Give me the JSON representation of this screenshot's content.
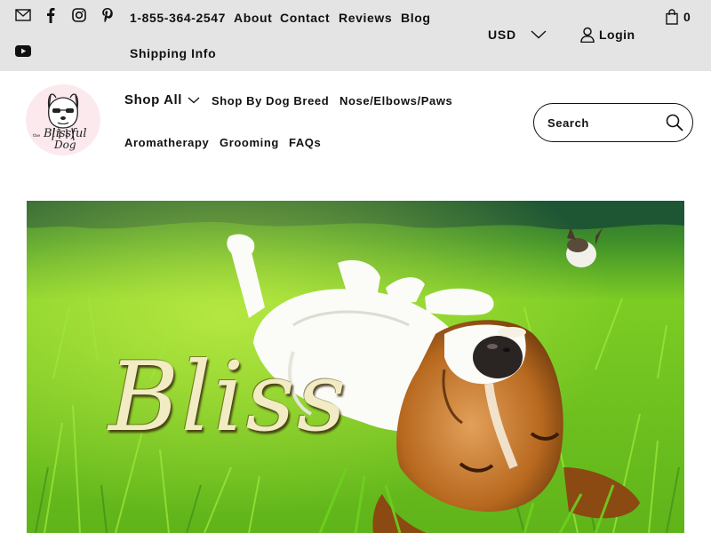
{
  "topbar": {
    "phone": "1-855-364-2547",
    "links": {
      "about": "About",
      "contact": "Contact",
      "reviews": "Reviews",
      "blog": "Blog",
      "shipping": "Shipping Info"
    },
    "social_icons": [
      "email-icon",
      "facebook-icon",
      "instagram-icon",
      "pinterest-icon",
      "youtube-icon"
    ],
    "currency": "USD",
    "login_label": "Login",
    "cart_count": "0"
  },
  "header": {
    "logo_text": {
      "the": "the",
      "name": "Blissful",
      "dog": "Dog"
    },
    "nav": {
      "shop_all": "Shop All",
      "shop_by_breed": "Shop By Dog Breed",
      "nose_elbows_paws": "Nose/Elbows/Paws",
      "aromatherapy": "Aromatherapy",
      "grooming": "Grooming",
      "faqs": "FAQs"
    },
    "search": {
      "placeholder": "Search"
    }
  },
  "hero": {
    "title": "Bliss"
  },
  "colors": {
    "topbar_bg": "#e4e4e4",
    "text": "#111111",
    "grass": "#6fc21e",
    "hero_script": "#f1ecc4"
  }
}
